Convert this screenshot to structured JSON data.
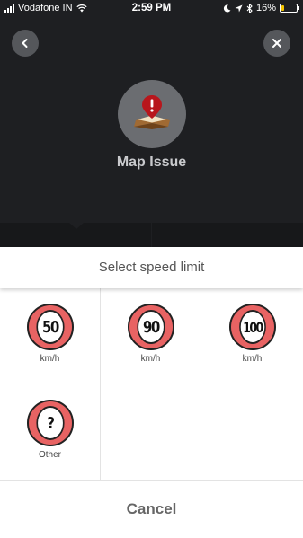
{
  "status_bar": {
    "carrier": "Vodafone IN",
    "time": "2:59 PM",
    "battery": "16%",
    "battery_level": 0.16
  },
  "header": {
    "title": "Map Issue",
    "back_icon": "chevron-left-icon",
    "close_icon": "close-icon",
    "issue_icon": "map-warning-icon"
  },
  "sheet": {
    "title": "Select speed limit",
    "options": [
      {
        "value": "50",
        "unit": "km/h"
      },
      {
        "value": "90",
        "unit": "km/h"
      },
      {
        "value": "100",
        "unit": "km/h"
      },
      {
        "value": "?",
        "unit": "Other"
      }
    ],
    "cancel_label": "Cancel"
  },
  "colors": {
    "sign_ring": "#e86363",
    "background": "#1e1f22",
    "battery": "#f5c400"
  }
}
